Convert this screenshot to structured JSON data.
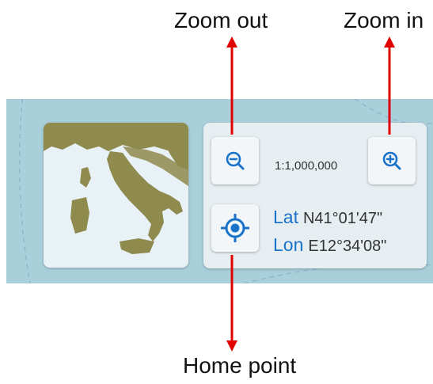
{
  "callouts": {
    "zoom_out": "Zoom out",
    "zoom_in": "Zoom in",
    "home_point": "Home point"
  },
  "panel": {
    "scale": "1:1,000,000",
    "lat_label": "Lat",
    "lat_value": "N41°01'47\"",
    "lon_label": "Lon",
    "lon_value": "E12°34'08\""
  },
  "icons": {
    "zoom_out": "zoom-out-icon",
    "zoom_in": "zoom-in-icon",
    "home": "crosshair-target-icon"
  },
  "colors": {
    "accent_blue": "#1a73c9",
    "arrow_red": "#e00000",
    "map_water": "#a9cfdb",
    "land": "#8f8a4e"
  }
}
